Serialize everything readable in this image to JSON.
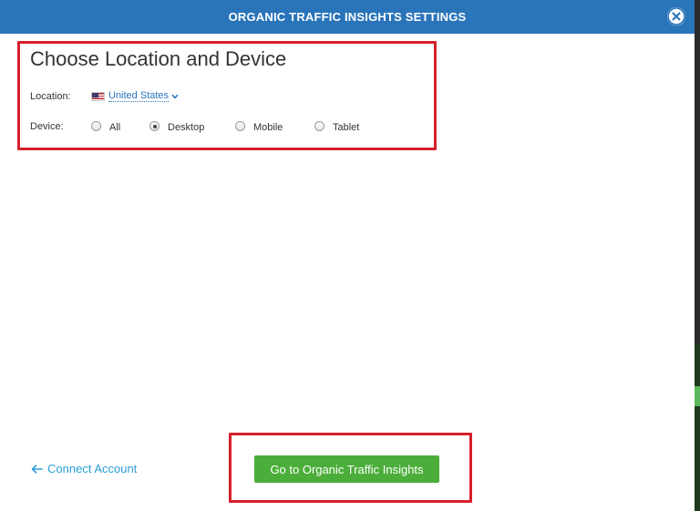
{
  "header": {
    "title": "ORGANIC TRAFFIC INSIGHTS SETTINGS",
    "close_icon": "close-circle-icon"
  },
  "section": {
    "title": "Choose Location and Device"
  },
  "location": {
    "label": "Location:",
    "value": "United States",
    "flag_icon": "us-flag-icon"
  },
  "device": {
    "label": "Device:",
    "options": [
      "All",
      "Desktop",
      "Mobile",
      "Tablet"
    ],
    "selected": "Desktop"
  },
  "footer": {
    "connect_label": "Connect Account",
    "go_label": "Go to Organic Traffic Insights"
  },
  "colors": {
    "header_bg": "#2a74ba",
    "highlight": "#d6202c",
    "button_green": "#4cae3a",
    "link_blue": "#2a9fd6"
  }
}
